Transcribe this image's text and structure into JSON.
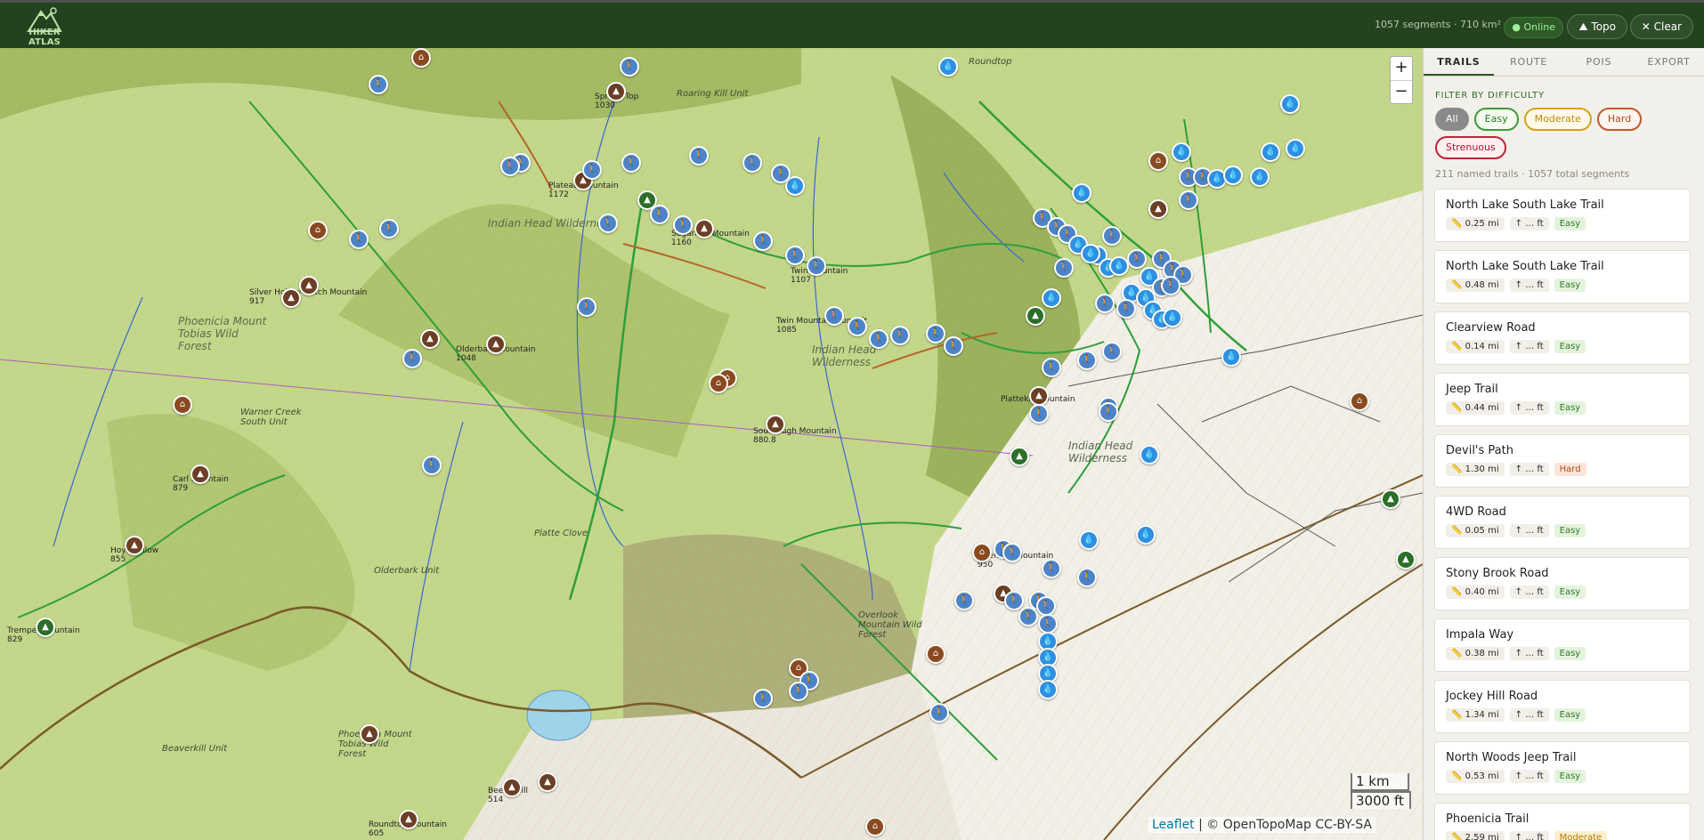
{
  "app": {
    "brand": "HIKER ATLAS"
  },
  "header": {
    "stats": "1057 segments · 710 km²",
    "status": "Online",
    "topo_label": "Topo",
    "clear_label": "Clear"
  },
  "map": {
    "zoom_in": "+",
    "zoom_out": "−",
    "scale_km": "1 km",
    "scale_ft": "3000 ft",
    "attribution_leaflet": "Leaflet",
    "attribution_rest": "| © OpenTopoMap CC-BY-SA",
    "labels": [
      "Indian Head Wilderness",
      "Phoenicia Mount Tobias Wild Forest",
      "Indian Head Wilderness",
      "Warner Creek South Unit",
      "Overlook Mountain Wild Forest",
      "Olderbark Unit",
      "Beaverkill Unit",
      "Phoenicia Mount Tobias Wild Forest",
      "Indian Head Wilderness",
      "Roaring Kill Unit",
      "Platte Clove",
      "Roundtop"
    ],
    "peaks": [
      {
        "name": "Spruce Top",
        "elev": "1030"
      },
      {
        "name": "Plateau Mountain",
        "elev": "1172"
      },
      {
        "name": "Sugarloaf Mountain",
        "elev": "1160"
      },
      {
        "name": "Twin Mountain",
        "elev": "1107"
      },
      {
        "name": "Twin Mountain Summit",
        "elev": "1085"
      },
      {
        "name": "Silver Hollow Notch Mountain",
        "elev": "917"
      },
      {
        "name": "Olderbark Mountain",
        "elev": "1048"
      },
      {
        "name": "Sourdough Mountain",
        "elev": "880.8"
      },
      {
        "name": "Carl Mountain",
        "elev": "879"
      },
      {
        "name": "Hoyt Hollow",
        "elev": "855"
      },
      {
        "name": "Tremper Mountain",
        "elev": "829"
      },
      {
        "name": "Plattekill Mountain",
        "elev": ""
      },
      {
        "name": "Overlook Mountain",
        "elev": "950"
      },
      {
        "name": "Beech Hill",
        "elev": "514"
      },
      {
        "name": "Roundtop Mountain",
        "elev": "605"
      }
    ]
  },
  "sidebar": {
    "tabs": [
      "TRAILS",
      "ROUTE",
      "POIS",
      "EXPORT"
    ],
    "filter_title": "FILTER BY DIFFICULTY",
    "chips": [
      "All",
      "Easy",
      "Moderate",
      "Hard",
      "Strenuous"
    ],
    "summary": "211 named trails · 1057 total segments",
    "trails": [
      {
        "name": "North Lake South Lake Trail",
        "dist": "0.25 mi",
        "gain": "… ft",
        "difficulty": "Easy"
      },
      {
        "name": "North Lake South Lake Trail",
        "dist": "0.48 mi",
        "gain": "… ft",
        "difficulty": "Easy"
      },
      {
        "name": "Clearview Road",
        "dist": "0.14 mi",
        "gain": "… ft",
        "difficulty": "Easy"
      },
      {
        "name": "Jeep Trail",
        "dist": "0.44 mi",
        "gain": "… ft",
        "difficulty": "Easy"
      },
      {
        "name": "Devil's Path",
        "dist": "1.30 mi",
        "gain": "… ft",
        "difficulty": "Hard"
      },
      {
        "name": "4WD Road",
        "dist": "0.05 mi",
        "gain": "… ft",
        "difficulty": "Easy"
      },
      {
        "name": "Stony Brook Road",
        "dist": "0.40 mi",
        "gain": "… ft",
        "difficulty": "Easy"
      },
      {
        "name": "Impala Way",
        "dist": "0.38 mi",
        "gain": "… ft",
        "difficulty": "Easy"
      },
      {
        "name": "Jockey Hill Road",
        "dist": "1.34 mi",
        "gain": "… ft",
        "difficulty": "Easy"
      },
      {
        "name": "North Woods Jeep Trail",
        "dist": "0.53 mi",
        "gain": "… ft",
        "difficulty": "Easy"
      },
      {
        "name": "Phoenicia Trail",
        "dist": "2.59 mi",
        "gain": "… ft",
        "difficulty": "Moderate"
      }
    ]
  },
  "colors": {
    "header_bg": "#24421f",
    "map_terrain": "#b9d277",
    "trail_green": "#2e9e3a",
    "water_marker": "#2f8fe0",
    "hiker_marker": "#4d84c8",
    "peak_marker": "#6b3f26"
  }
}
